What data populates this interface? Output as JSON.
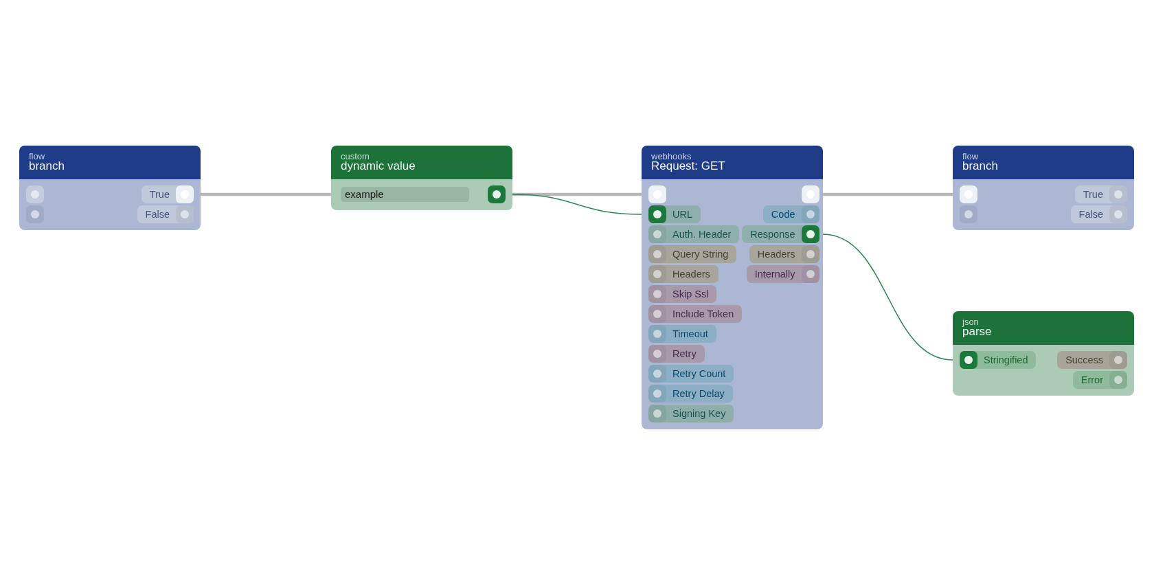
{
  "nodes": [
    {
      "category": "flow",
      "title": "branch",
      "color": "#1f3c88",
      "inputs": [
        {
          "kind": "flow",
          "color": "#c4ccdf",
          "connected": false
        },
        {
          "kind": "data",
          "color": "#a0abc7",
          "connected": false
        }
      ],
      "outputs": [
        {
          "label": "True",
          "kind": "flow",
          "color": "#c0c9dc",
          "connected": true
        },
        {
          "label": "False",
          "kind": "flow",
          "color": "#c0c9dc",
          "connected": false
        }
      ]
    },
    {
      "category": "custom",
      "title": "dynamic value",
      "color": "#1c7239",
      "field": {
        "value": "example"
      },
      "outputs": [
        {
          "kind": "data",
          "connected": true
        }
      ]
    },
    {
      "category": "webhooks",
      "title": "Request: GET",
      "color": "#1f3c88",
      "inputs": [
        {
          "kind": "flow",
          "connected": true
        },
        {
          "label": "URL",
          "kind": "data",
          "color": "#8fafad",
          "connected": true
        },
        {
          "label": "Auth. Header",
          "kind": "data",
          "color": "#8fafad",
          "connected": false
        },
        {
          "label": "Query String",
          "kind": "data",
          "color": "#a7a59c",
          "connected": false
        },
        {
          "label": "Headers",
          "kind": "data",
          "color": "#a7a59c",
          "connected": false
        },
        {
          "label": "Skip Ssl",
          "kind": "data",
          "color": "#a99aab",
          "connected": false
        },
        {
          "label": "Include Token",
          "kind": "data",
          "color": "#a99aab",
          "connected": false
        },
        {
          "label": "Timeout",
          "kind": "data",
          "color": "#8cafc5",
          "connected": false
        },
        {
          "label": "Retry",
          "kind": "data",
          "color": "#a99aab",
          "connected": false
        },
        {
          "label": "Retry Count",
          "kind": "data",
          "color": "#8cafc5",
          "connected": false
        },
        {
          "label": "Retry Delay",
          "kind": "data",
          "color": "#8cafc5",
          "connected": false
        },
        {
          "label": "Signing Key",
          "kind": "data",
          "color": "#8eaeaa",
          "connected": false
        }
      ],
      "outputs": [
        {
          "kind": "flow",
          "connected": true
        },
        {
          "label": "Code",
          "kind": "data",
          "color": "#8cafc5",
          "connected": false
        },
        {
          "label": "Response",
          "kind": "data",
          "color": "#8fafad",
          "connected": true
        },
        {
          "label": "Headers",
          "kind": "data",
          "color": "#a7a59c",
          "connected": false
        },
        {
          "label": "Internally",
          "kind": "data",
          "color": "#a99aab",
          "connected": false
        }
      ]
    },
    {
      "category": "flow",
      "title": "branch",
      "color": "#1f3c88",
      "inputs": [
        {
          "kind": "flow",
          "connected": true
        },
        {
          "kind": "data",
          "color": "#a0abc7",
          "connected": false
        }
      ],
      "outputs": [
        {
          "label": "True",
          "kind": "flow",
          "color": "#c0c9dc",
          "connected": false
        },
        {
          "label": "False",
          "kind": "flow",
          "color": "#c0c9dc",
          "connected": false
        }
      ]
    },
    {
      "category": "json",
      "title": "parse",
      "color": "#1c7239",
      "inputs": [
        {
          "label": "Stringified",
          "kind": "data",
          "color": "#8fba9b",
          "connected": true
        }
      ],
      "outputs": [
        {
          "label": "Success",
          "kind": "data",
          "color": "#a8a49a",
          "connected": false
        },
        {
          "label": "Error",
          "kind": "data",
          "color": "#8fba9b",
          "connected": false
        }
      ]
    }
  ]
}
